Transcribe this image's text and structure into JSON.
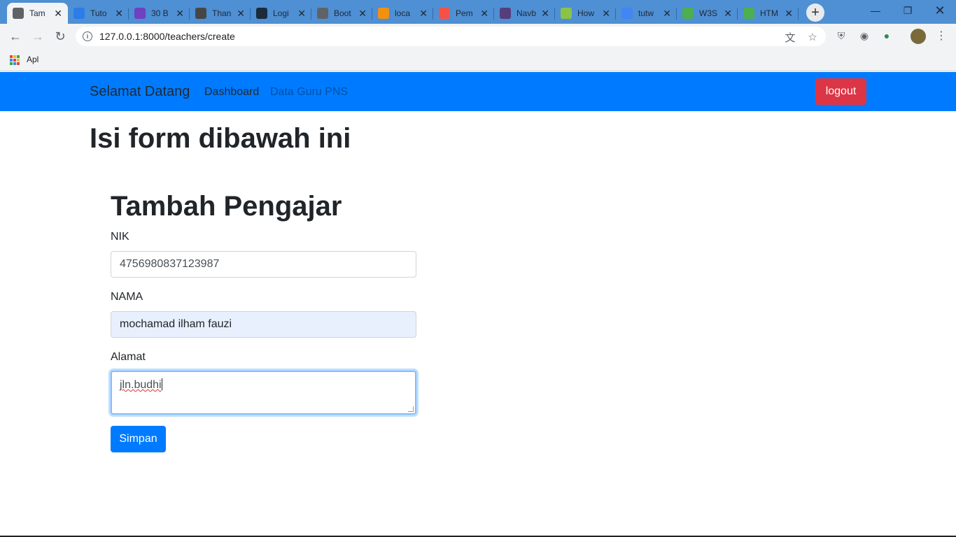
{
  "browser": {
    "tabs": [
      {
        "label": "Tam",
        "icon": "globe-icon",
        "color": "#5f6368",
        "active": true
      },
      {
        "label": "Tuto",
        "icon": "link-icon",
        "color": "#2b7de9"
      },
      {
        "label": "30 B",
        "icon": "colorlib-icon",
        "color": "#6f42c1"
      },
      {
        "label": "Than",
        "icon": "wordpress-icon",
        "color": "#464646"
      },
      {
        "label": "Logi",
        "icon": "home-icon",
        "color": "#1c2a3a"
      },
      {
        "label": "Boot",
        "icon": "globe-icon",
        "color": "#5f6368"
      },
      {
        "label": "loca",
        "icon": "phpmyadmin-icon",
        "color": "#f29111"
      },
      {
        "label": "Pem",
        "icon": "laravel-icon",
        "color": "#f55247"
      },
      {
        "label": "Navb",
        "icon": "bootstrap-icon",
        "color": "#563d7c"
      },
      {
        "label": "How",
        "icon": "howto-icon",
        "color": "#8bc34a"
      },
      {
        "label": "tutw",
        "icon": "google-icon",
        "color": "#4285f4"
      },
      {
        "label": "W3S",
        "icon": "w3schools-icon",
        "color": "#4caf50"
      },
      {
        "label": "HTM",
        "icon": "w3schools-icon",
        "color": "#4caf50"
      }
    ],
    "url": "127.0.0.1:8000/teachers/create",
    "bookmark_apps": "Apl"
  },
  "navbar": {
    "brand": "Selamat Datang",
    "link_dashboard": "Dashboard",
    "link_data": "Data Guru PNS",
    "logout": "logout"
  },
  "page": {
    "title": "Isi form dibawah ini",
    "form_title": "Tambah Pengajar",
    "nik_label": "NIK",
    "nik_value": "4756980837123987",
    "nama_label": "NAMA",
    "nama_value": "mochamad ilham fauzi",
    "alamat_label": "Alamat",
    "alamat_value": "jln.budhi",
    "submit": "Simpan"
  },
  "colors": {
    "primary": "#007bff",
    "danger": "#dc3545",
    "tabstrip": "#4f8fd3"
  }
}
